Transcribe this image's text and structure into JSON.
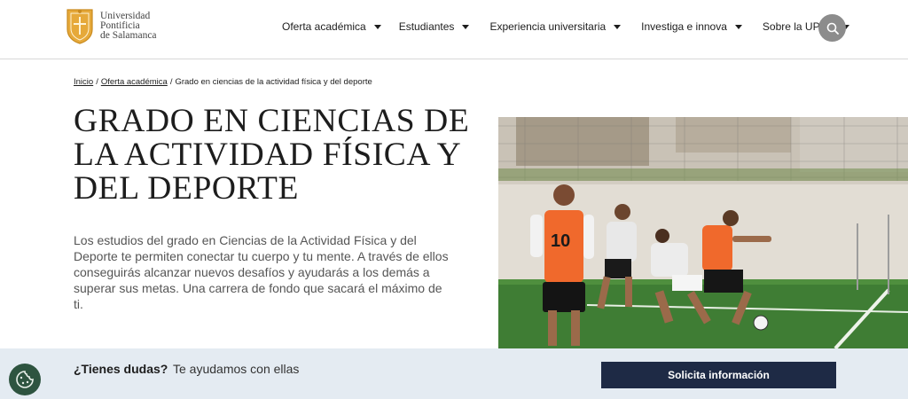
{
  "brand": {
    "name_lines": [
      "Universidad",
      "Pontificia",
      "de Salamanca"
    ],
    "seal_color": "#e0a93a"
  },
  "nav": {
    "items": [
      {
        "label": "Oferta académica"
      },
      {
        "label": "Estudiantes"
      },
      {
        "label": "Experiencia universitaria"
      },
      {
        "label": "Investiga e innova"
      },
      {
        "label": "Sobre la UPSA"
      }
    ],
    "search_icon": "search-icon"
  },
  "breadcrumb": {
    "home": "Inicio",
    "section": "Oferta académica",
    "current": "Grado en ciencias de la actividad física y del deporte"
  },
  "page": {
    "title": "Grado en ciencias de la actividad física y del deporte",
    "intro": "Los estudios del grado en Ciencias de la Actividad Física y del Deporte te permiten conectar tu cuerpo y tu mente. A través de ellos conseguirás alcanzar nuevos desafíos y ayudarás a los demás a superar sus metas. Una carrera de fondo que sacará el máximo de ti.",
    "hero_jersey_number": "10"
  },
  "cta": {
    "question": "¿Tienes dudas?",
    "subtitle": "Te ayudamos con ellas",
    "button": "Solicita información",
    "button_color": "#1e2a45",
    "bar_color": "#e4ebf2"
  },
  "cookie": {
    "icon": "cookie-icon",
    "color": "#2e5440"
  }
}
